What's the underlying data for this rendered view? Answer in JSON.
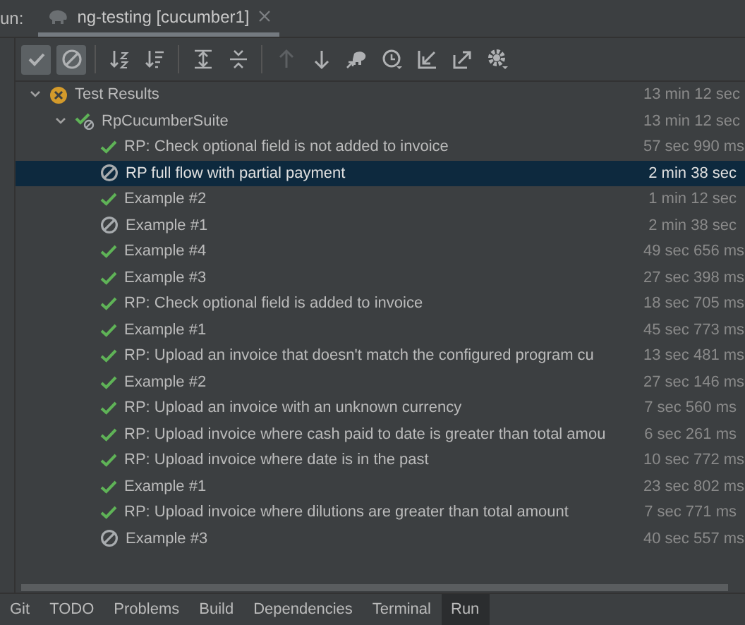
{
  "run_tab": {
    "prefix": "un:",
    "title": "ng-testing [cucumber1]"
  },
  "toolbar": [
    {
      "kind": "passed",
      "selected": true,
      "disabled": false
    },
    {
      "kind": "ignored",
      "selected": true,
      "disabled": false
    },
    {
      "kind": "sort-alpha",
      "selected": false,
      "disabled": false
    },
    {
      "kind": "sort-duration",
      "selected": false,
      "disabled": false
    },
    {
      "kind": "expand",
      "selected": false,
      "disabled": false
    },
    {
      "kind": "collapse",
      "selected": false,
      "disabled": false
    },
    {
      "kind": "up",
      "selected": false,
      "disabled": true
    },
    {
      "kind": "down",
      "selected": false,
      "disabled": false
    },
    {
      "kind": "import",
      "selected": false,
      "disabled": false
    },
    {
      "kind": "history",
      "selected": false,
      "disabled": false
    },
    {
      "kind": "import-file",
      "selected": false,
      "disabled": false
    },
    {
      "kind": "export",
      "selected": false,
      "disabled": false
    },
    {
      "kind": "settings",
      "selected": false,
      "disabled": false
    }
  ],
  "tree": {
    "name": "Test Results",
    "kind": "failed",
    "time": "13 min 12 sec",
    "expanded": true,
    "selected": false,
    "children": [
      {
        "name": "RpCucumberSuite",
        "kind": "mixed",
        "time": "13 min 12 sec",
        "expanded": true,
        "selected": false,
        "children": [
          {
            "name": "RP: Check optional field is not added to invoice",
            "kind": "passed",
            "time": "57 sec 990 ms",
            "selected": false
          },
          {
            "name": "RP full flow with partial payment",
            "kind": "ignored",
            "time": "2 min 38 sec",
            "selected": true
          },
          {
            "name": "Example #2",
            "kind": "passed",
            "time": "1 min 12 sec",
            "selected": false
          },
          {
            "name": "Example #1",
            "kind": "ignored",
            "time": "2 min 38 sec",
            "selected": false
          },
          {
            "name": "Example #4",
            "kind": "passed",
            "time": "49 sec 656 ms",
            "selected": false
          },
          {
            "name": "Example #3",
            "kind": "passed",
            "time": "27 sec 398 ms",
            "selected": false
          },
          {
            "name": "RP: Check optional field is added to invoice",
            "kind": "passed",
            "time": "18 sec 705 ms",
            "selected": false
          },
          {
            "name": "Example #1",
            "kind": "passed",
            "time": "45 sec 773 ms",
            "selected": false
          },
          {
            "name": "RP: Upload an invoice that doesn't match the configured program cu",
            "kind": "passed",
            "time": "13 sec 481 ms",
            "selected": false
          },
          {
            "name": "Example #2",
            "kind": "passed",
            "time": "27 sec 146 ms",
            "selected": false
          },
          {
            "name": "RP: Upload an invoice with an unknown currency",
            "kind": "passed",
            "time": "7 sec 560 ms",
            "selected": false
          },
          {
            "name": "RP: Upload invoice where cash paid to date is greater than total amou",
            "kind": "passed",
            "time": "6 sec 261 ms",
            "selected": false
          },
          {
            "name": "RP: Upload invoice where date is in the past",
            "kind": "passed",
            "time": "10 sec 772 ms",
            "selected": false
          },
          {
            "name": "Example #1",
            "kind": "passed",
            "time": "23 sec 802 ms",
            "selected": false
          },
          {
            "name": "RP: Upload invoice where dilutions are greater than total amount",
            "kind": "passed",
            "time": "7 sec 771 ms",
            "selected": false
          },
          {
            "name": "Example #3",
            "kind": "ignored",
            "time": "40 sec 557 ms",
            "selected": false
          }
        ]
      }
    ]
  },
  "bottom_tabs": [
    {
      "label": "Git",
      "selected": false
    },
    {
      "label": "TODO",
      "selected": false
    },
    {
      "label": "Problems",
      "selected": false
    },
    {
      "label": "Build",
      "selected": false
    },
    {
      "label": "Dependencies",
      "selected": false
    },
    {
      "label": "Terminal",
      "selected": false
    },
    {
      "label": "Run",
      "selected": true
    }
  ]
}
